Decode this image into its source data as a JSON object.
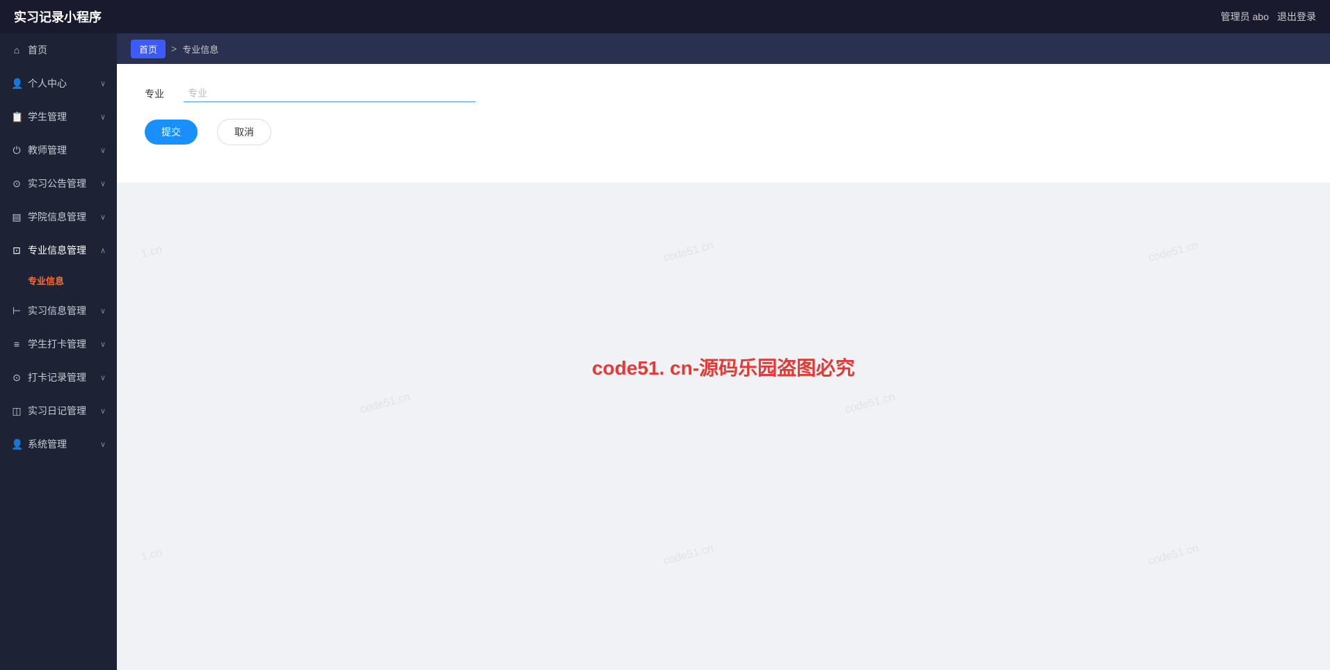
{
  "header": {
    "title": "实习记录小程序",
    "admin_label": "管理员 abo",
    "logout_label": "退出登录"
  },
  "sidebar": {
    "items": [
      {
        "id": "home",
        "label": "首页",
        "icon": "⌂",
        "has_children": false
      },
      {
        "id": "personal",
        "label": "个人中心",
        "icon": "👤",
        "has_children": true
      },
      {
        "id": "student",
        "label": "学生管理",
        "icon": "📋",
        "has_children": true
      },
      {
        "id": "teacher",
        "label": "教师管理",
        "icon": "⏻",
        "has_children": true
      },
      {
        "id": "announcement",
        "label": "实习公告管理",
        "icon": "⊙",
        "has_children": true
      },
      {
        "id": "school-info",
        "label": "学院信息管理",
        "icon": "▤",
        "has_children": true
      },
      {
        "id": "major-info",
        "label": "专业信息管理",
        "icon": "⊡",
        "has_children": true,
        "expanded": true
      },
      {
        "id": "internship-info",
        "label": "实习信息管理",
        "icon": "⊢",
        "has_children": true
      },
      {
        "id": "checkin",
        "label": "学生打卡管理",
        "icon": "≡",
        "has_children": true
      },
      {
        "id": "checkin-record",
        "label": "打卡记录管理",
        "icon": "⊙",
        "has_children": true
      },
      {
        "id": "diary",
        "label": "实习日记管理",
        "icon": "◫",
        "has_children": true
      },
      {
        "id": "system",
        "label": "系统管理",
        "icon": "👤",
        "has_children": true
      }
    ],
    "sub_items": {
      "major-info": [
        {
          "id": "major",
          "label": "专业信息",
          "active": true
        }
      ]
    }
  },
  "breadcrumb": {
    "home_label": "首页",
    "separator": ">",
    "current_label": "专业信息"
  },
  "form": {
    "major_label": "专业",
    "major_placeholder": "专业",
    "submit_label": "提交",
    "cancel_label": "取消"
  },
  "watermark": {
    "text": "code51.cn",
    "center_text": "code51. cn-源码乐园盗图必究"
  }
}
